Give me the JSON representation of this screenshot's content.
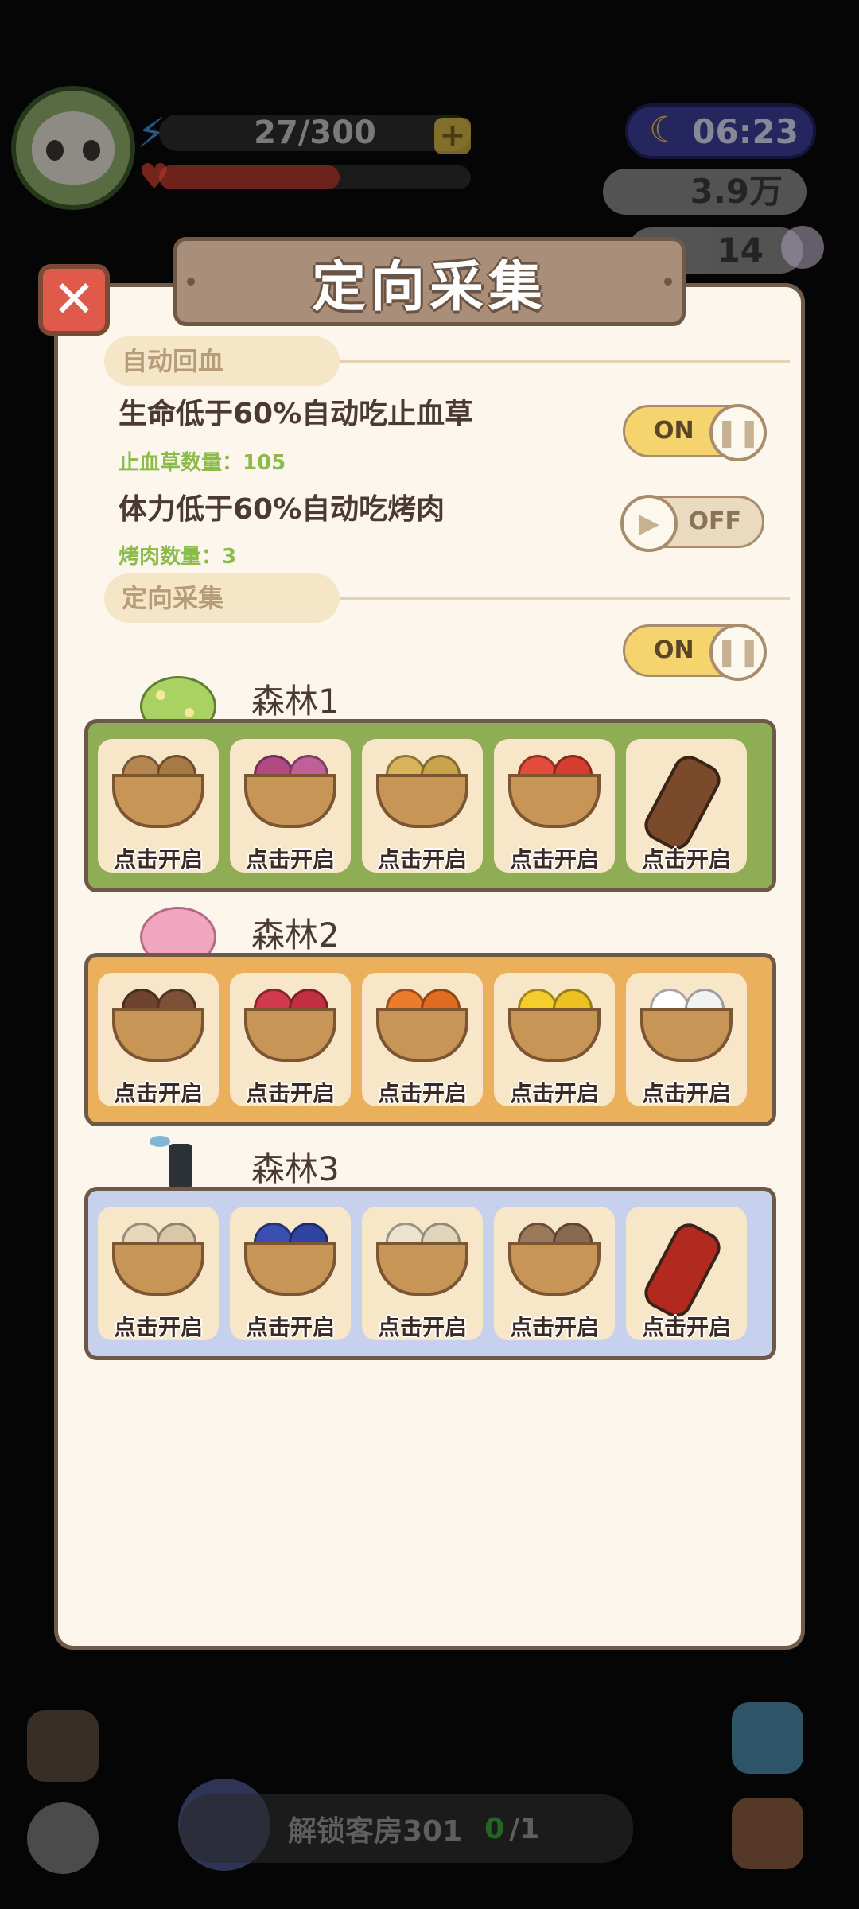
{
  "hud": {
    "energy": "27/300",
    "plus": "+",
    "time": "06:23",
    "money": "3.9万",
    "pearls": "14"
  },
  "bottom": {
    "task": "解锁客房301",
    "progress_done": "0",
    "progress_total": "/1"
  },
  "modal": {
    "title": "定向采集",
    "close": "✕",
    "section_auto_heal": "自动回血",
    "rule_hp": "生命低于60%自动吃止血草",
    "rule_hp_count": "止血草数量：105",
    "toggle_hp": "ON",
    "rule_stamina": "体力低于60%自动吃烤肉",
    "rule_stamina_count": "烤肉数量：3",
    "toggle_stamina": "OFF",
    "section_gather": "定向采集",
    "toggle_gather": "ON",
    "slot_label": "点击开启"
  },
  "forests": [
    {
      "name": "森林1",
      "bg": "#8fad55"
    },
    {
      "name": "森林2",
      "bg": "#ebb05b"
    },
    {
      "name": "森林3",
      "bg": "#c7d0ec"
    }
  ],
  "colors": {
    "modal_bg": "#fcf6ec",
    "border": "#6e5847",
    "accent_green": "#8bbb4a",
    "toggle_on": "#f5d46d"
  }
}
